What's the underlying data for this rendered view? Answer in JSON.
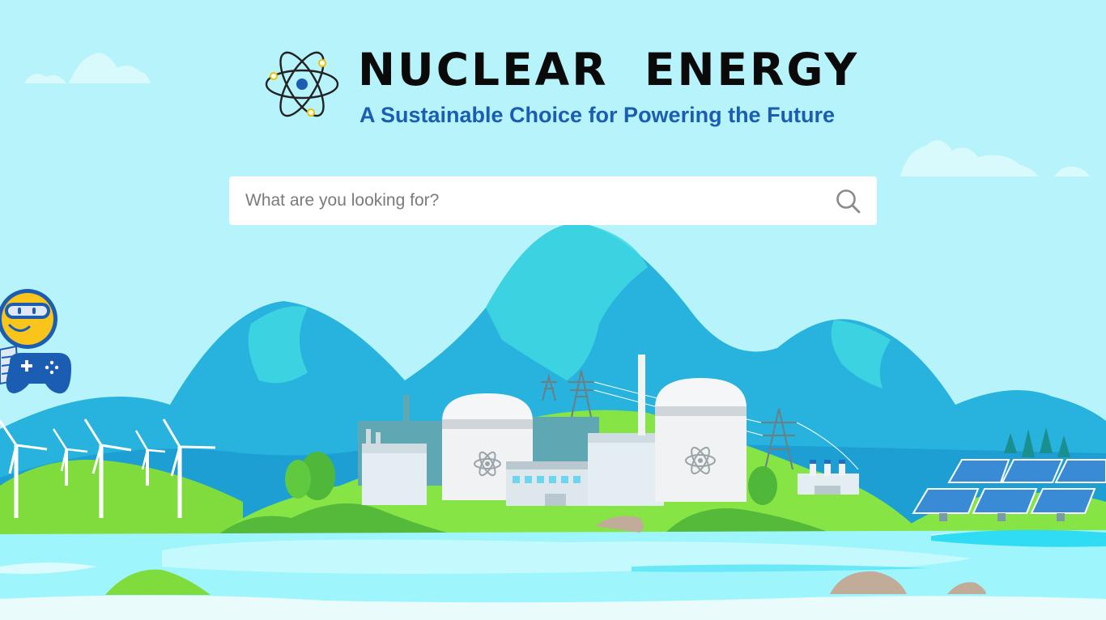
{
  "header": {
    "title": "NUCLEAR  ENERGY",
    "subtitle": "A Sustainable Choice for Powering the Future",
    "logo_icon": "atom-icon"
  },
  "search": {
    "placeholder": "What are you looking for?",
    "value": "",
    "icon": "search-icon"
  },
  "floating_widget": {
    "icon": "game-controller-mascot-icon"
  },
  "colors": {
    "sky": "#b6f3fb",
    "mountain": "#2ec6e0",
    "grass": "#86e444",
    "water": "#9ef6fc",
    "subtitle": "#1a5db3",
    "title": "#0a0a0a"
  }
}
